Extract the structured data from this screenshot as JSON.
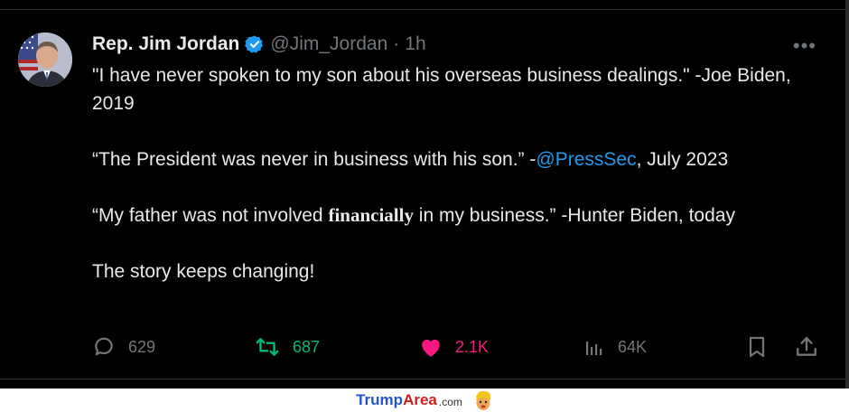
{
  "tweet": {
    "display_name": "Rep. Jim Jordan",
    "handle": "@Jim_Jordan",
    "separator": "·",
    "time": "1h",
    "more_label": "•••",
    "paragraphs": [
      {
        "text": "\"I have never spoken to my son about his overseas business dealings.\" -Joe Biden, 2019"
      },
      {
        "pre": "“The President was never in business with his son.” -",
        "mention": "@PressSec",
        "post": ", July 2023"
      },
      {
        "pre": "“My father was not involved ",
        "emphasis": "financially",
        "post": " in my business.” -Hunter Biden, today"
      },
      {
        "text": "The story keeps changing!"
      }
    ]
  },
  "actions": {
    "reply_count": "629",
    "retweet_count": "687",
    "like_count": "2.1K",
    "views_count": "64K"
  },
  "colors": {
    "background": "#000000",
    "text": "#e7e9ea",
    "muted": "#71767b",
    "mention": "#1d9bf0",
    "retweet": "#00ba7c",
    "like": "#f91880",
    "verified": "#1d9bf0"
  },
  "icons": [
    "verified-badge-icon",
    "more-icon",
    "reply-icon",
    "retweet-icon",
    "like-icon",
    "views-icon",
    "bookmark-icon",
    "share-icon",
    "mascot-icon"
  ],
  "watermark": {
    "part1": "Trump",
    "part2": "Area",
    "part3": ".com"
  }
}
